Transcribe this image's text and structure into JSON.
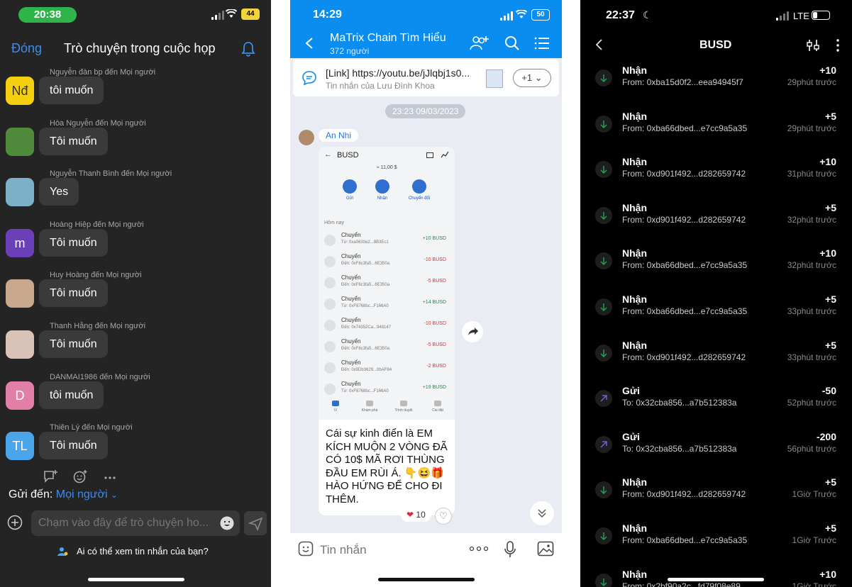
{
  "zoom": {
    "status": {
      "time": "20:38",
      "battery": "44"
    },
    "header": {
      "close_label": "Đóng",
      "title": "Trò chuyện trong cuộc họp"
    },
    "messages": [
      {
        "sender": "Nguyễn đàn bp đến Mọi người",
        "avatar_text": "Nđ",
        "avatar_color": "#f5d010",
        "avatar_text_color": "#333",
        "text": "tôi muốn"
      },
      {
        "sender": "Hòa Nguyễn đến Mọi người",
        "avatar_text": "",
        "avatar_color": "#4f8a3c",
        "avatar_text_color": "#fff",
        "text": "Tôi muốn"
      },
      {
        "sender": "Nguyễn Thanh Bình đến Mọi người",
        "avatar_text": "",
        "avatar_color": "#7bb0c6",
        "avatar_text_color": "#fff",
        "text": "Yes"
      },
      {
        "sender": "Hoàng Hiệp đến Mọi người",
        "avatar_text": "m",
        "avatar_color": "#6a3fb8",
        "avatar_text_color": "#fff",
        "text": "Tôi muốn"
      },
      {
        "sender": "Huy Hoàng đến Mọi người",
        "avatar_text": "",
        "avatar_color": "#c9a98e",
        "avatar_text_color": "#fff",
        "text": "Tôi muốn"
      },
      {
        "sender": "Thanh Hằng đến Mọi người",
        "avatar_text": "",
        "avatar_color": "#d8c3b6",
        "avatar_text_color": "#fff",
        "text": "Tôi muốn"
      },
      {
        "sender": "DANMAI1986 đến Mọi người",
        "avatar_text": "D",
        "avatar_color": "#e27fa6",
        "avatar_text_color": "#fff",
        "text": "tôi muốn"
      },
      {
        "sender": "Thiên Lý đến Mọi người",
        "avatar_text": "TL",
        "avatar_color": "#4aa5ea",
        "avatar_text_color": "#fff",
        "text": "Tôi muốn"
      }
    ],
    "send_to": {
      "label": "Gửi đến:",
      "target": "Mọi người"
    },
    "input_placeholder": "Chạm vào đây để trò chuyện ho...",
    "privacy": "Ai có thể xem tin nhắn của bạn?"
  },
  "zalo": {
    "status": {
      "time": "14:29",
      "battery": "50"
    },
    "header": {
      "group_name": "MaTrix Chain Tìm Hiểu",
      "members": "372 người"
    },
    "pinned": {
      "title": "[Link] https://youtu.be/jJlqbj1s0...",
      "subtitle": "Tin nhắn của Lưu Đình Khoa",
      "more": "+1"
    },
    "date": "23:23 09/03/2023",
    "author": "An Nhi",
    "screenshot": {
      "title": "BUSD",
      "balance": "≈ 11,00 $",
      "actions": [
        "Gửi",
        "Nhận",
        "Chuyển đổi"
      ],
      "section": "Hôm nay",
      "transactions": [
        {
          "kind": "Chuyển",
          "addr": "Từ: 0xa0630e2...8B3Ec1",
          "value": "+10 BUSD",
          "color": "#1f8a4c"
        },
        {
          "kind": "Chuyển",
          "addr": "Đến: 0xF6c3fa5...6E350a",
          "value": "-10 BUSD",
          "color": "#d6333a"
        },
        {
          "kind": "Chuyển",
          "addr": "Đến: 0xF6c3fa5...6E350a",
          "value": "-5 BUSD",
          "color": "#d6333a"
        },
        {
          "kind": "Chuyển",
          "addr": "Từ: 0xF8768bc...F166A0",
          "value": "+14 BUSD",
          "color": "#1f8a4c"
        },
        {
          "kind": "Chuyển",
          "addr": "Đến: 0x74352Ca...948147",
          "value": "-10 BUSD",
          "color": "#d6333a"
        },
        {
          "kind": "Chuyển",
          "addr": "Đến: 0xF6c3fa5...6E350a",
          "value": "-5 BUSD",
          "color": "#d6333a"
        },
        {
          "kind": "Chuyển",
          "addr": "Đến: 0x9Db3629...0bAF84",
          "value": "-2 BUSD",
          "color": "#d6333a"
        },
        {
          "kind": "Chuyển",
          "addr": "Từ: 0xF8768bc...F166A0",
          "value": "+19 BUSD",
          "color": "#1f8a4c"
        }
      ],
      "nav": [
        "Ví",
        "Khám phá",
        "Trình duyệt",
        "Cài đặt"
      ]
    },
    "caption": "Cái sự kinh điển là EM KÍCH MUỘN 2 VÒNG ĐÃ CÓ 10$ MÃ RƠI THÙNG ĐẦU EM RÙI Á. 👇😆🎁 HÀO HỨNG ĐỂ CHO ĐI THÊM.",
    "reaction_count": "10",
    "input_placeholder": "Tin nhắn"
  },
  "wallet": {
    "status": {
      "time": "22:37",
      "network": "LTE"
    },
    "title": "BUSD",
    "rows": [
      {
        "kind": "Nhận",
        "addr": "From: 0xba15d0f2...eea94945f7",
        "amount": "+10",
        "ago": "29phút trước",
        "direction": "in"
      },
      {
        "kind": "Nhận",
        "addr": "From: 0xba66dbed...e7cc9a5a35",
        "amount": "+5",
        "ago": "29phút trước",
        "direction": "in"
      },
      {
        "kind": "Nhận",
        "addr": "From: 0xd901f492...d282659742",
        "amount": "+10",
        "ago": "31phút trước",
        "direction": "in"
      },
      {
        "kind": "Nhận",
        "addr": "From: 0xd901f492...d282659742",
        "amount": "+5",
        "ago": "32phút trước",
        "direction": "in"
      },
      {
        "kind": "Nhận",
        "addr": "From: 0xba66dbed...e7cc9a5a35",
        "amount": "+10",
        "ago": "32phút trước",
        "direction": "in"
      },
      {
        "kind": "Nhận",
        "addr": "From: 0xba66dbed...e7cc9a5a35",
        "amount": "+5",
        "ago": "33phút trước",
        "direction": "in"
      },
      {
        "kind": "Nhận",
        "addr": "From: 0xd901f492...d282659742",
        "amount": "+5",
        "ago": "33phút trước",
        "direction": "in"
      },
      {
        "kind": "Gửi",
        "addr": "To: 0x32cba856...a7b512383a",
        "amount": "-50",
        "ago": "52phút trước",
        "direction": "out"
      },
      {
        "kind": "Gửi",
        "addr": "To: 0x32cba856...a7b512383a",
        "amount": "-200",
        "ago": "56phút trước",
        "direction": "out"
      },
      {
        "kind": "Nhận",
        "addr": "From: 0xd901f492...d282659742",
        "amount": "+5",
        "ago": "1Giờ Trước",
        "direction": "in"
      },
      {
        "kind": "Nhận",
        "addr": "From: 0xba66dbed...e7cc9a5a35",
        "amount": "+5",
        "ago": "1Giờ Trước",
        "direction": "in"
      },
      {
        "kind": "Nhận",
        "addr": "From: 0x2bf90a2c...fd79f08e89",
        "amount": "+10",
        "ago": "1Giờ Trước",
        "direction": "in"
      }
    ]
  }
}
